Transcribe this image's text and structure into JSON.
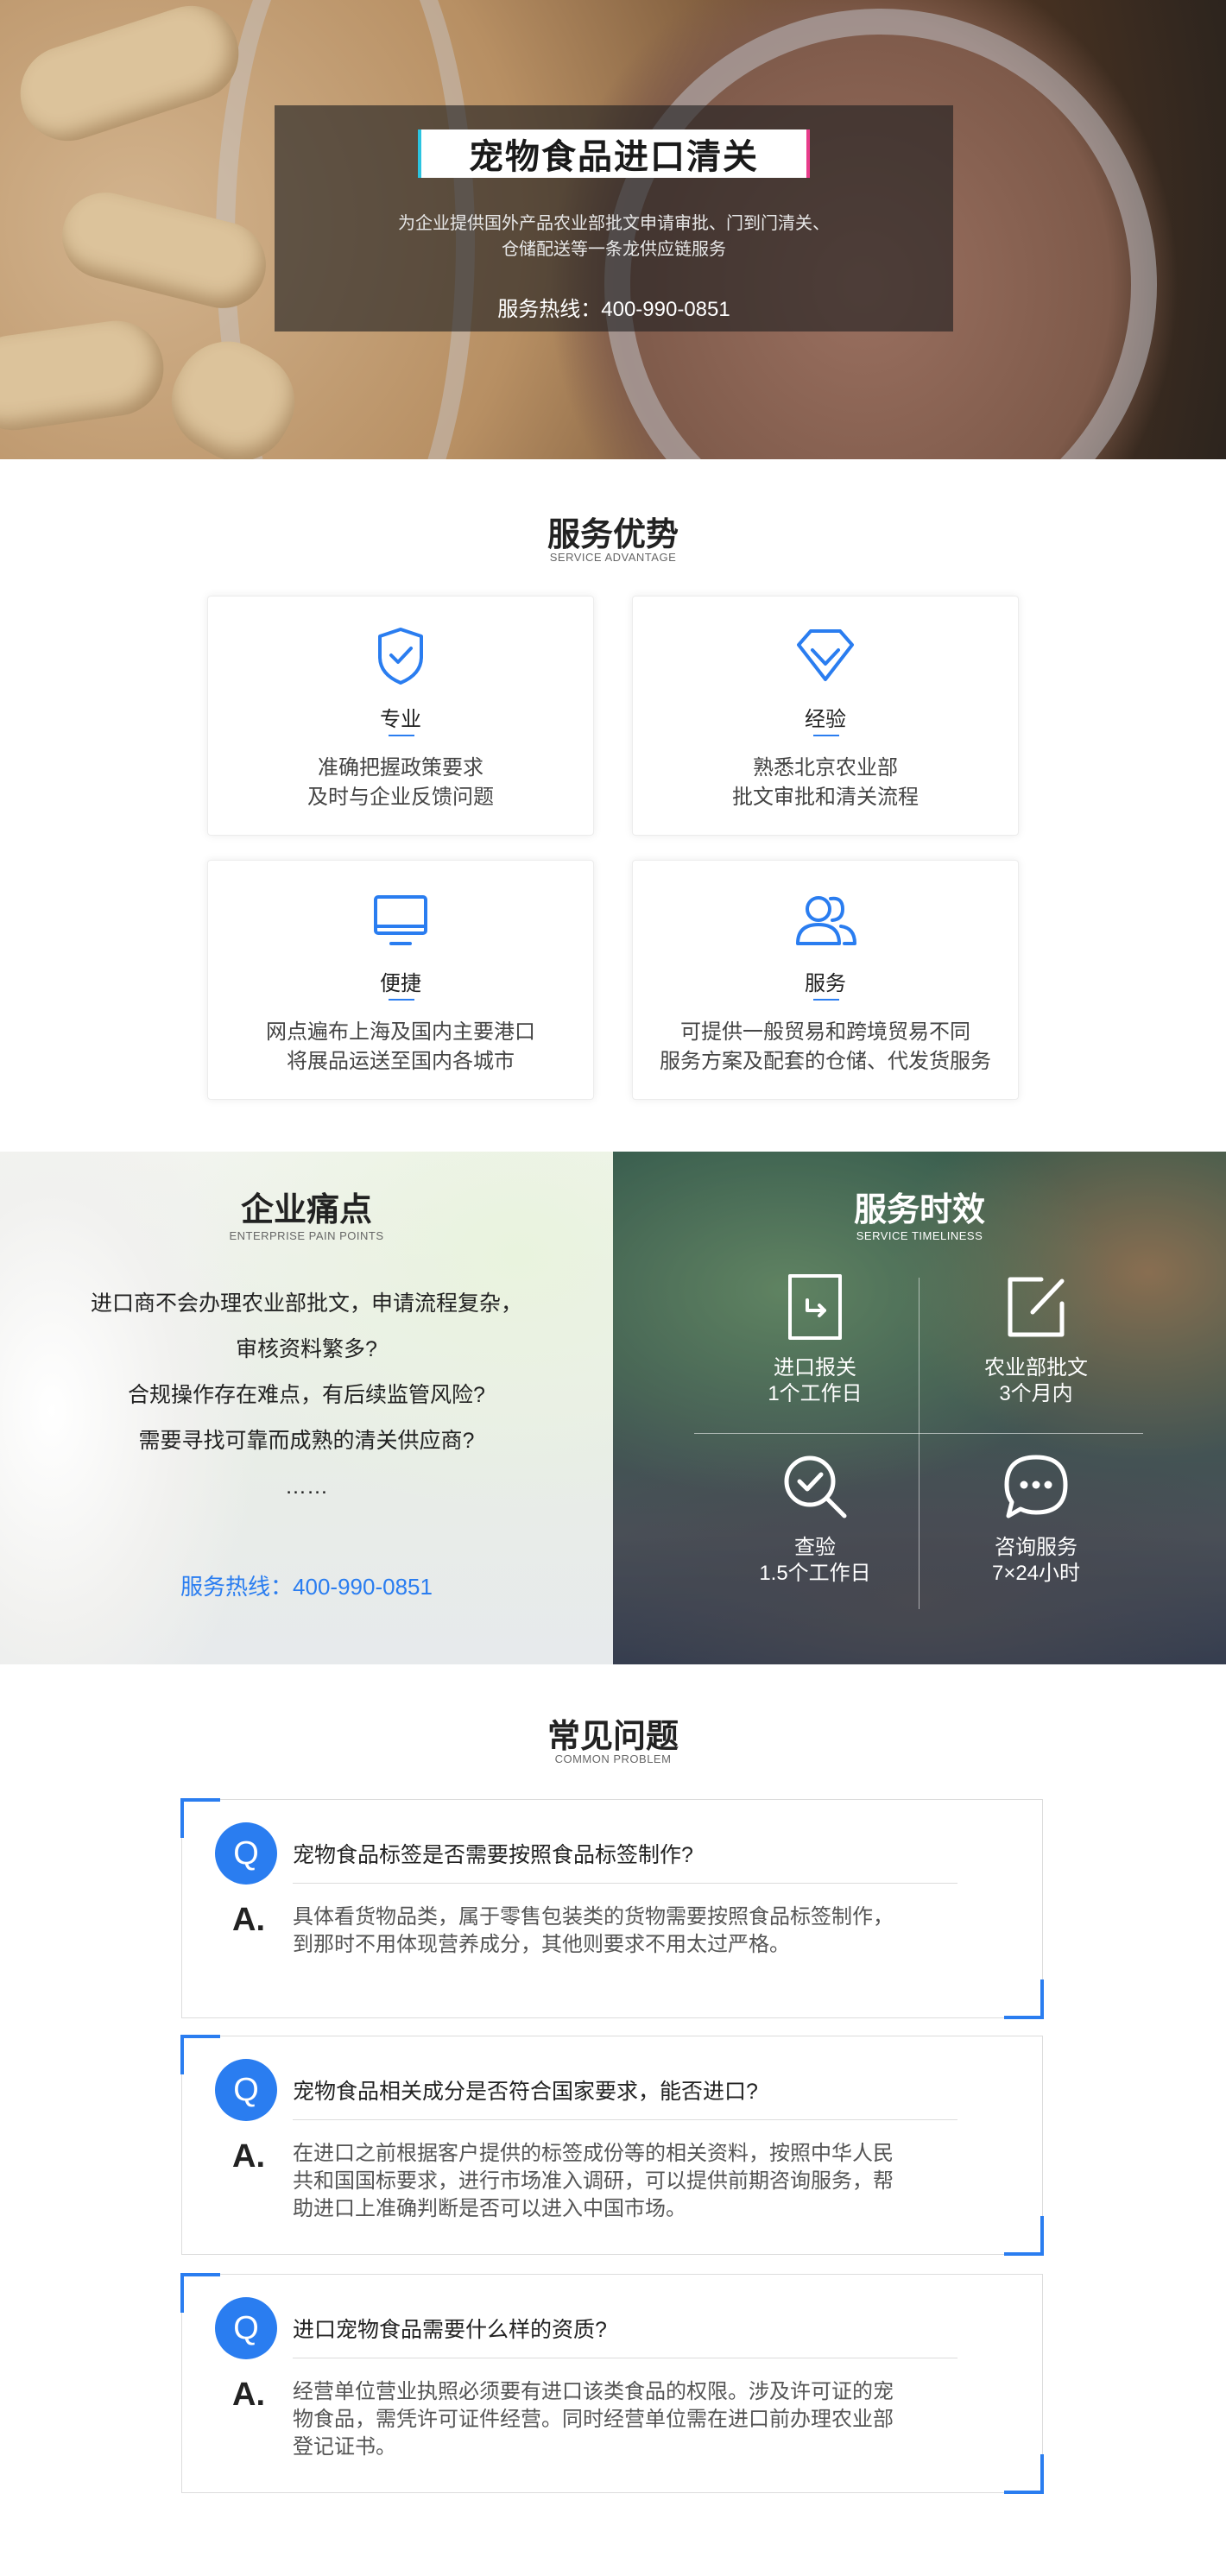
{
  "hero": {
    "title": "宠物食品进口清关",
    "subtitle_line1": "为企业提供国外产品农业部批文申请审批、门到门清关、",
    "subtitle_line2": "仓储配送等一条龙供应链服务",
    "hotline": "服务热线：400-990-0851"
  },
  "advantage": {
    "title": "服务优势",
    "subtitle": "SERVICE ADVANTAGE",
    "cards": [
      {
        "icon": "shield-check-icon",
        "title": "专业",
        "line1": "准确把握政策要求",
        "line2": "及时与企业反馈问题"
      },
      {
        "icon": "diamond-icon",
        "title": "经验",
        "line1": "熟悉北京农业部",
        "line2": "批文审批和清关流程"
      },
      {
        "icon": "monitor-icon",
        "title": "便捷",
        "line1": "网点遍布上海及国内主要港口",
        "line2": "将展品运送至国内各城市"
      },
      {
        "icon": "users-icon",
        "title": "服务",
        "line1": "可提供一般贸易和跨境贸易不同",
        "line2": "服务方案及配套的仓储、代发货服务"
      }
    ]
  },
  "pain": {
    "title": "企业痛点",
    "subtitle": "ENTERPRISE PAIN POINTS",
    "lines": [
      "进口商不会办理农业部批文，申请流程复杂，",
      "审核资料繁多?",
      "合规操作存在难点，有后续监管风险?",
      "需要寻找可靠而成熟的清关供应商?",
      "……"
    ],
    "hotline": "服务热线：400-990-0851"
  },
  "timeliness": {
    "title": "服务时效",
    "subtitle": "SERVICE TIMELINESS",
    "items": [
      {
        "icon": "document-arrow-icon",
        "label1": "进口报关",
        "label2": "1个工作日"
      },
      {
        "icon": "edit-icon",
        "label1": "农业部批文",
        "label2": "3个月内"
      },
      {
        "icon": "magnify-check-icon",
        "label1": "查验",
        "label2": "1.5个工作日"
      },
      {
        "icon": "chat-bubble-icon",
        "label1": "咨询服务",
        "label2": "7×24小时"
      }
    ]
  },
  "faq": {
    "title": "常见问题",
    "subtitle": "COMMON PROBLEM",
    "q_mark": "Q",
    "a_mark": "A.",
    "items": [
      {
        "question": "宠物食品标签是否需要按照食品标签制作?",
        "answer": "具体看货物品类，属于零售包装类的货物需要按照食品标签制作，到那时不用体现营养成分，其他则要求不用太过严格。"
      },
      {
        "question": "宠物食品相关成分是否符合国家要求，能否进口?",
        "answer": "在进口之前根据客户提供的标签成份等的相关资料，按照中华人民共和国国标要求，进行市场准入调研，可以提供前期咨询服务，帮助进口上准确判断是否可以进入中国市场。"
      },
      {
        "question": "进口宠物食品需要什么样的资质?",
        "answer": "经营单位营业执照必须要有进口该类食品的权限。涉及许可证的宠物食品，需凭许可证件经营。同时经营单位需在进口前办理农业部登记证书。"
      }
    ]
  },
  "colors": {
    "accent": "#2a7df0",
    "dark_overlay": "#1e1e20"
  }
}
